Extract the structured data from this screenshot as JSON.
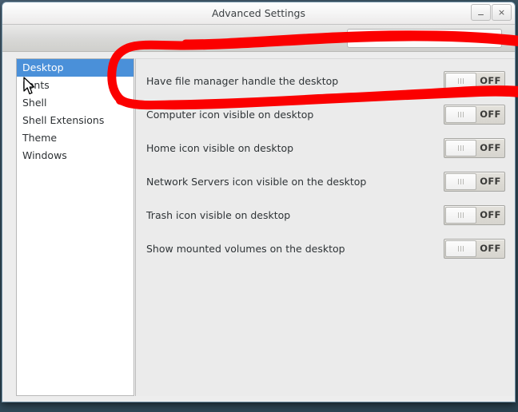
{
  "window": {
    "title": "Advanced Settings",
    "minimize_label": "_",
    "close_label": "×"
  },
  "toolbar": {
    "search_placeholder": "",
    "search_value": "",
    "search_icon": "search-icon"
  },
  "sidebar": {
    "items": [
      {
        "label": "Desktop",
        "selected": true
      },
      {
        "label": "Fonts",
        "selected": false
      },
      {
        "label": "Shell",
        "selected": false
      },
      {
        "label": "Shell Extensions",
        "selected": false
      },
      {
        "label": "Theme",
        "selected": false
      },
      {
        "label": "Windows",
        "selected": false
      }
    ]
  },
  "settings": {
    "rows": [
      {
        "label": "Have file manager handle the desktop",
        "state": "OFF"
      },
      {
        "label": "Computer icon visible on desktop",
        "state": "OFF"
      },
      {
        "label": "Home icon visible on desktop",
        "state": "OFF"
      },
      {
        "label": "Network Servers icon visible on the desktop",
        "state": "OFF"
      },
      {
        "label": "Trash icon visible on desktop",
        "state": "OFF"
      },
      {
        "label": "Show mounted volumes on the desktop",
        "state": "OFF"
      }
    ]
  },
  "annotation": {
    "color": "#fb0000",
    "shape": "hand-drawn-ellipse",
    "targets": "Have file manager handle the desktop row"
  },
  "colors": {
    "selection_blue": "#4a90d9",
    "panel_bg": "#ebebeb",
    "sidebar_bg": "#ffffff",
    "annotation_red": "#fb0000"
  }
}
